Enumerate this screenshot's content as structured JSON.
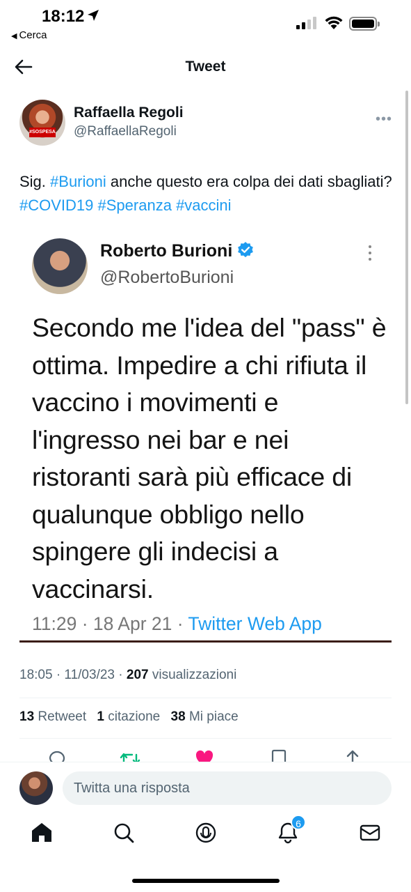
{
  "status_bar": {
    "time": "18:12",
    "back_label": "Cerca"
  },
  "header": {
    "title": "Tweet"
  },
  "tweet": {
    "author_name": "Raffaella Regoli",
    "author_handle": "@RaffaellaRegoli",
    "avatar_sign": "#SOSPESA",
    "text_parts": {
      "p1": "Sig. ",
      "tag1": "#Burioni",
      "p2": " anche questo era colpa dei dati sbagliati? ",
      "tag2": "#COVID19",
      "p3": " ",
      "tag3": "#Speranza",
      "p4": " ",
      "tag4": "#vaccini"
    },
    "embedded": {
      "name": "Roberto Burioni",
      "handle": "@RobertoBurioni",
      "body": "Secondo me l'idea del \"pass\" è ottima. Impedire a chi rifiuta il vaccino i movimenti e l'ingresso nei bar e nei ristoranti sarà più efficace di qualunque obbligo nello spingere gli indecisi a vaccinarsi.",
      "timestamp": "11:29 · 18 Apr 21 · ",
      "app": "Twitter Web App"
    },
    "meta": {
      "datetime": "18:05 · 11/03/23 · ",
      "views_count": "207",
      "views_label": " visualizzazioni"
    },
    "stats": {
      "retweets_count": "13",
      "retweets_label": " Retweet",
      "quotes_count": "1",
      "quotes_label": " citazione",
      "likes_count": "38",
      "likes_label": " Mi piace"
    }
  },
  "reply": {
    "placeholder": "Twitta una risposta"
  },
  "nav": {
    "notifications_badge": "6",
    "items": [
      "home-icon",
      "search-icon",
      "spaces-icon",
      "bell-icon",
      "mail-icon"
    ]
  },
  "colors": {
    "accent": "#1d9bf0",
    "like": "#f91880",
    "retweet": "#00ba7c"
  }
}
